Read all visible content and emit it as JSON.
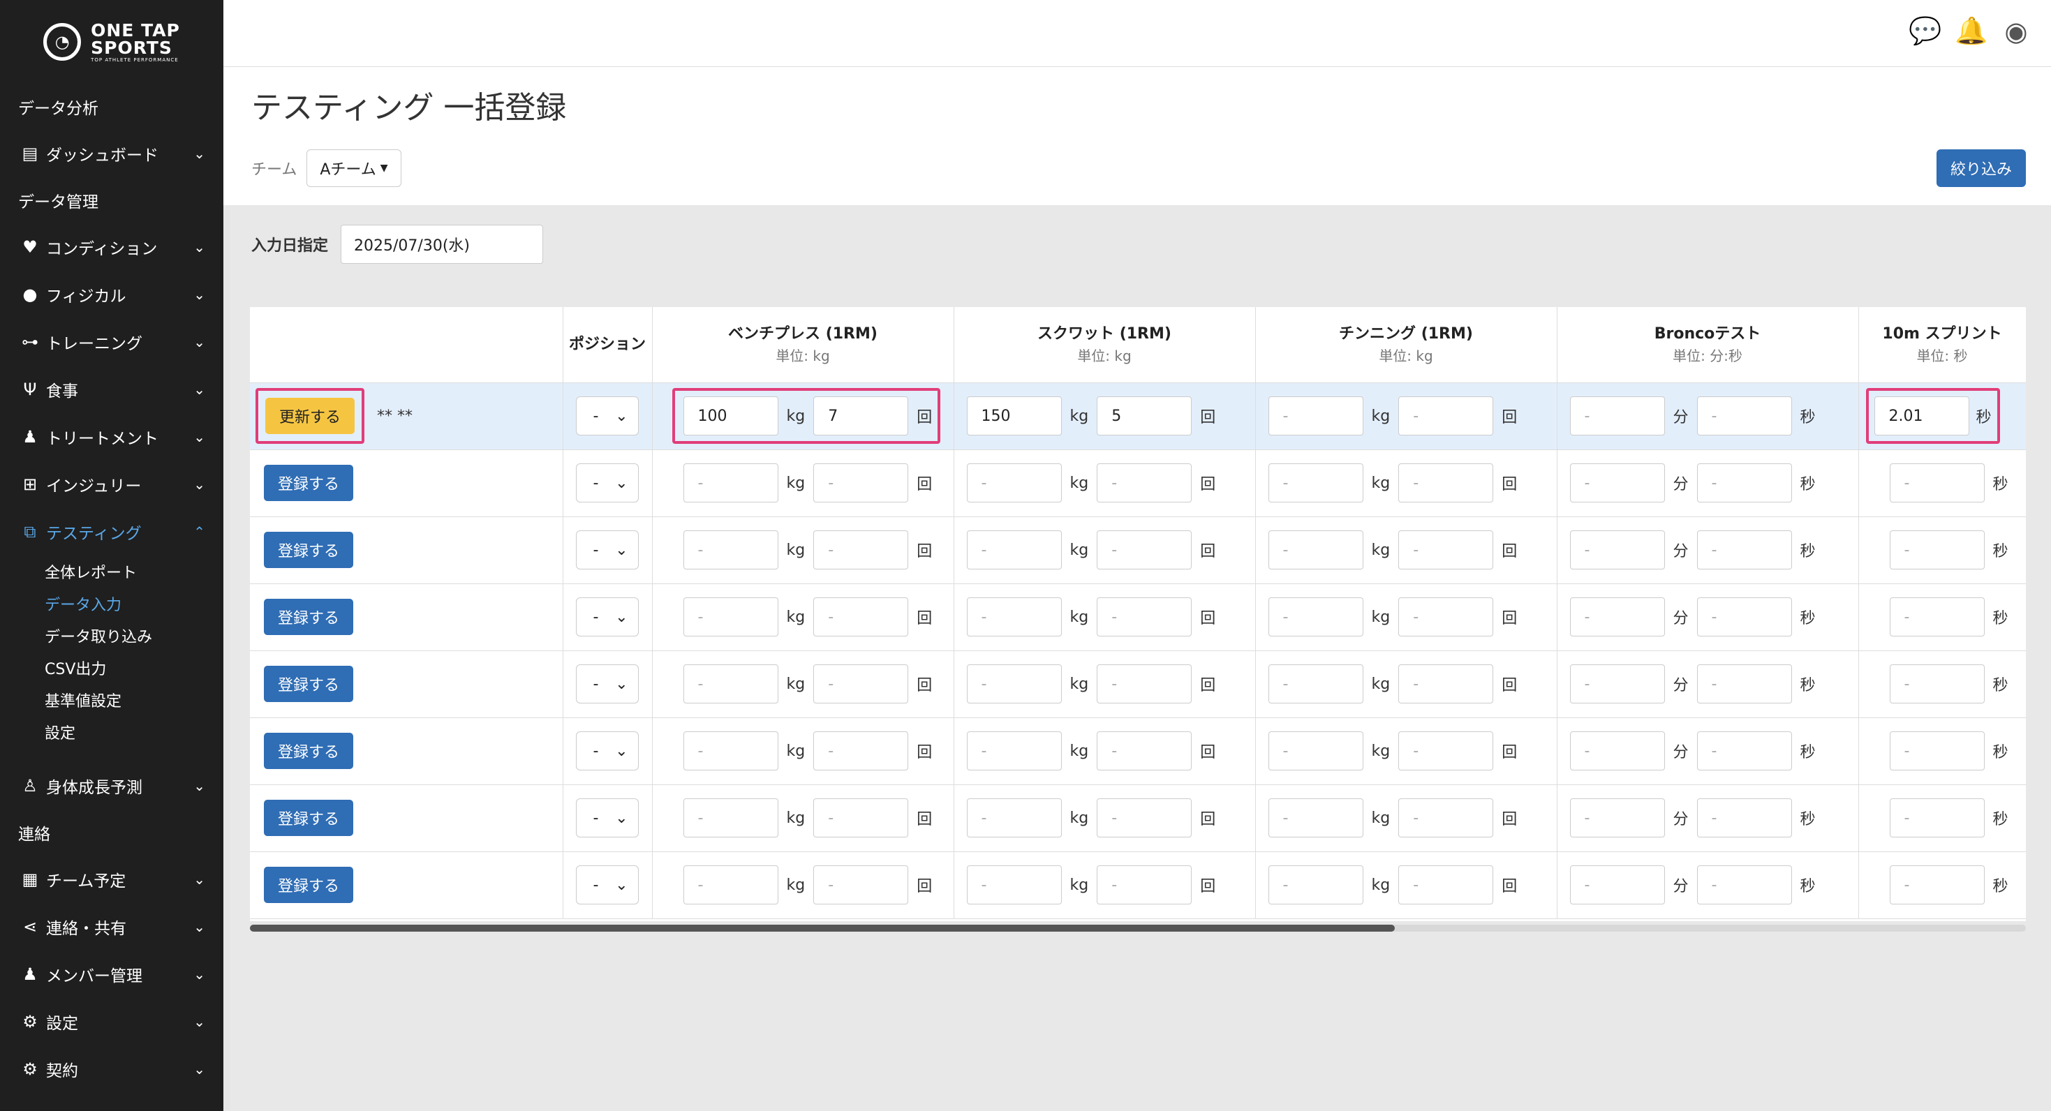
{
  "logo": {
    "line1": "ONE TAP",
    "line2": "SPORTS",
    "tagline": "TOP ATHLETE PERFORMANCE"
  },
  "sidebar": {
    "group_analysis": "データ分析",
    "dashboard": "ダッシュボード",
    "group_manage": "データ管理",
    "condition": "コンディション",
    "physical": "フィジカル",
    "training": "トレーニング",
    "meal": "食事",
    "treatment": "トリートメント",
    "injury": "インジュリー",
    "testing": "テスティング",
    "testing_sub": [
      "全体レポート",
      "データ入力",
      "データ取り込み",
      "CSV出力",
      "基準値設定",
      "設定"
    ],
    "growth": "身体成長予測",
    "group_contact": "連絡",
    "team_schedule": "チーム予定",
    "contact_share": "連絡・共有",
    "member": "メンバー管理",
    "settings": "設定",
    "contract": "契約"
  },
  "page": {
    "title": "テスティング 一括登録",
    "team_label": "チーム",
    "team_value": "Aチーム",
    "filter_button": "絞り込み",
    "date_label": "入力日指定",
    "date_value": "2025/07/30(水)"
  },
  "table": {
    "headers": {
      "position": "ポジション",
      "bench": "ベンチプレス (1RM)",
      "squat": "スクワット (1RM)",
      "chinning": "チンニング (1RM)",
      "bronco": "Broncoテスト",
      "sprint": "10m スプリント"
    },
    "units": {
      "bench": "単位: kg",
      "squat": "単位: kg",
      "chinning": "単位: kg",
      "bronco": "単位: 分:秒",
      "sprint": "単位: 秒"
    },
    "labels": {
      "kg": "kg",
      "reps": "回",
      "min": "分",
      "sec": "秒",
      "dash": "-"
    },
    "update_button": "更新する",
    "register_button": "登録する",
    "masked_name": "** **",
    "first_row": {
      "bench_kg": "100",
      "bench_reps": "7",
      "squat_kg": "150",
      "squat_reps": "5",
      "sprint_sec": "2.01"
    }
  }
}
